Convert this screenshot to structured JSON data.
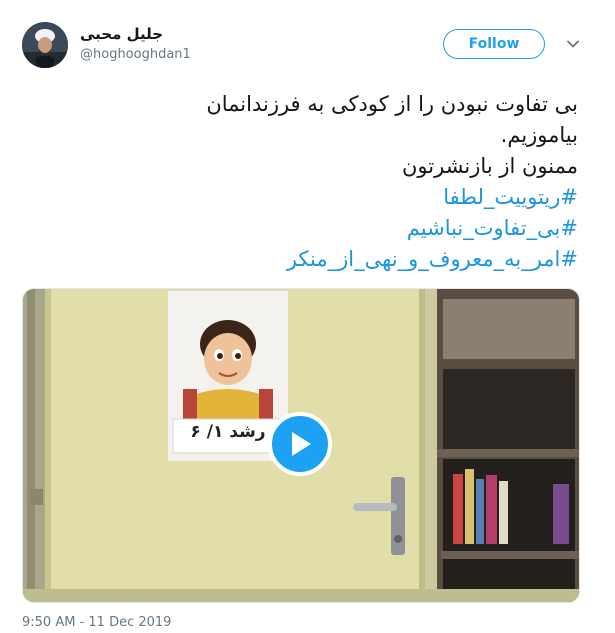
{
  "user": {
    "display_name": "جلیل محبی",
    "handle": "@hoghooghdan1"
  },
  "follow_button": {
    "label": "Follow"
  },
  "tweet": {
    "line1": "بی تفاوت نبودن را از کودکی به فرزندانمان",
    "line2": "بیاموزیم.",
    "line3": "ممنون از بازنشرتون",
    "hashtags": [
      "#ریتوییت_لطفا",
      "#بی_تفاوت_نباشیم",
      "#امر_به_معروف_و_نهی_از_منکر"
    ]
  },
  "media": {
    "poster_sign_text": "رشد ۱/ ۶"
  },
  "timestamp": "9:50 AM - 11 Dec 2019",
  "colors": {
    "accent": "#1da1f2",
    "hashtag": "#1b95e0",
    "secondary_text": "#657786"
  },
  "icons": {
    "more": "chevron-down-icon",
    "play": "play-icon"
  }
}
